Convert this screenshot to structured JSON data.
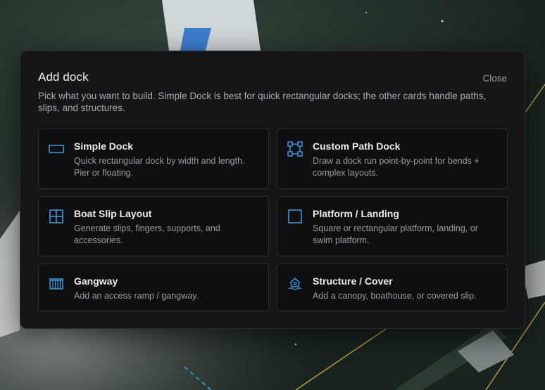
{
  "modal": {
    "title": "Add dock",
    "close_label": "Close",
    "description": "Pick what you want to build. Simple Dock is best for quick rectangular docks; the other cards handle paths, slips, and structures."
  },
  "cards": [
    {
      "title": "Simple Dock",
      "description": "Quick rectangular dock by width and length. Pier or floating.",
      "icon": "rectangle-icon"
    },
    {
      "title": "Custom Path Dock",
      "description": "Draw a dock run point-by-point for bends + complex layouts.",
      "icon": "path-nodes-icon"
    },
    {
      "title": "Boat Slip Layout",
      "description": "Generate slips, fingers, supports, and accessories.",
      "icon": "grid-icon"
    },
    {
      "title": "Platform / Landing",
      "description": "Square or rectangular platform, landing, or swim platform.",
      "icon": "square-icon"
    },
    {
      "title": "Gangway",
      "description": "Add an access ramp / gangway.",
      "icon": "gangway-icon"
    },
    {
      "title": "Structure / Cover",
      "description": "Add a canopy, boathouse, or covered slip.",
      "icon": "boathouse-icon"
    }
  ],
  "colors": {
    "accent": "#3aa0e8",
    "modal_bg": "#161618",
    "card_bg": "#0f0f11"
  }
}
